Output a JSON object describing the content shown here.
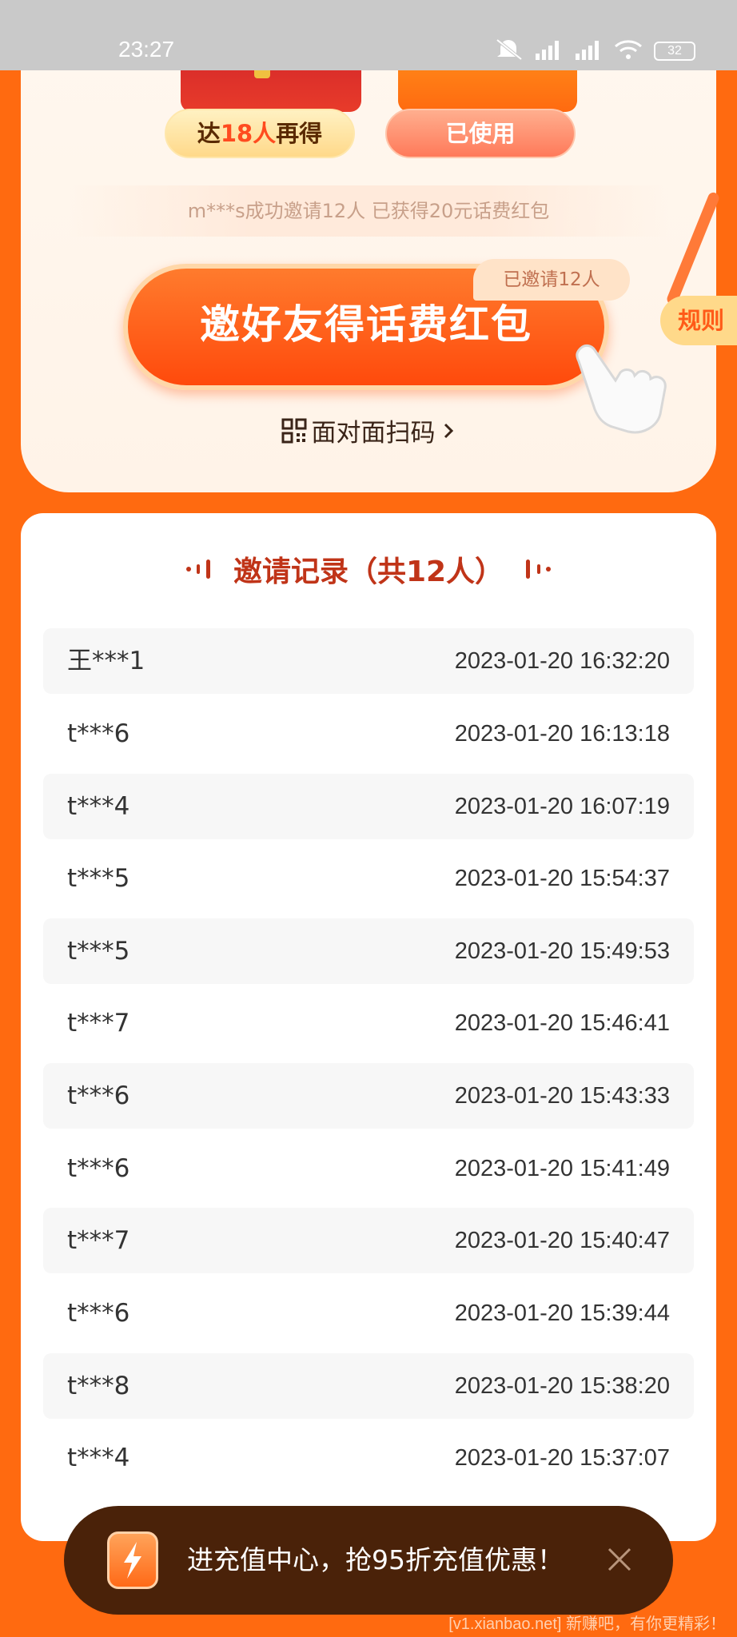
{
  "status_bar": {
    "time": "23:27",
    "battery": "32"
  },
  "prize_cards": {
    "reach_prefix": "达",
    "reach_number": "18人",
    "reach_suffix": "再得",
    "used_label": "已使用"
  },
  "tip": "m***s成功邀请12人 已获得20元话费红包",
  "invite_button": "邀好友得话费红包",
  "invited_tag": "已邀请12人",
  "face_to_face": "面对面扫码",
  "rules_tab": "规则",
  "records": {
    "title": "邀请记录（共12人）",
    "rows": [
      {
        "name": "王***1",
        "time": "2023-01-20 16:32:20"
      },
      {
        "name": "t***6",
        "time": "2023-01-20 16:13:18"
      },
      {
        "name": "t***4",
        "time": "2023-01-20 16:07:19"
      },
      {
        "name": "t***5",
        "time": "2023-01-20 15:54:37"
      },
      {
        "name": "t***5",
        "time": "2023-01-20 15:49:53"
      },
      {
        "name": "t***7",
        "time": "2023-01-20 15:46:41"
      },
      {
        "name": "t***6",
        "time": "2023-01-20 15:43:33"
      },
      {
        "name": "t***6",
        "time": "2023-01-20 15:41:49"
      },
      {
        "name": "t***7",
        "time": "2023-01-20 15:40:47"
      },
      {
        "name": "t***6",
        "time": "2023-01-20 15:39:44"
      },
      {
        "name": "t***8",
        "time": "2023-01-20 15:38:20"
      },
      {
        "name": "t***4",
        "time": "2023-01-20 15:37:07"
      }
    ]
  },
  "toast": {
    "text": "进充值中心，抢95折充值优惠！"
  },
  "watermark": "[v1.xianbao.net] 新赚吧，有你更精彩！",
  "colors": {
    "page_bg": "#ff6a10",
    "title": "#c03418",
    "toast_bg": "#4a2209"
  }
}
